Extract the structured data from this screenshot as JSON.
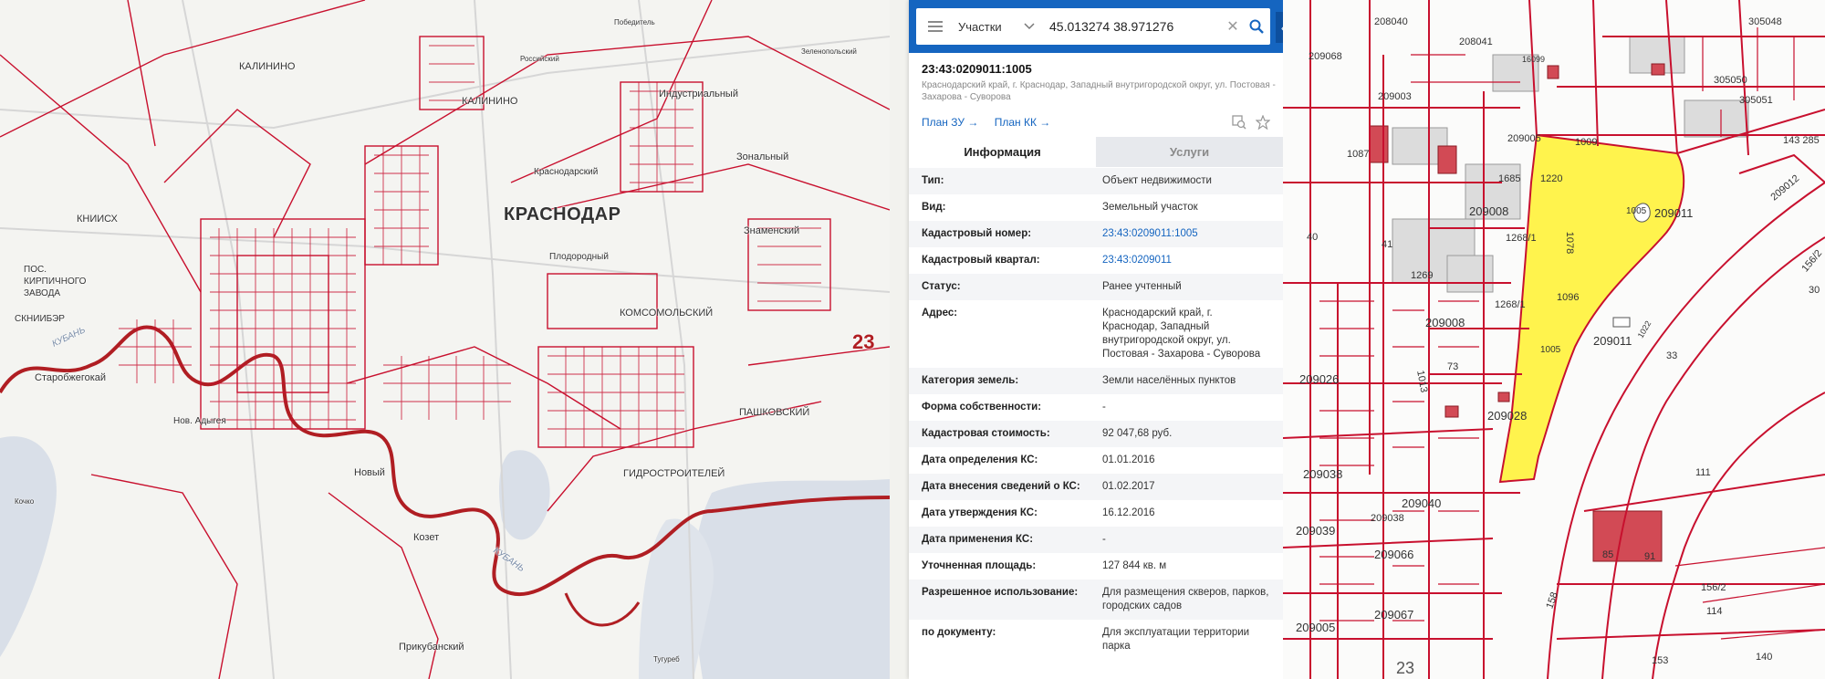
{
  "map_left": {
    "city_label": "КРАСНОДАР",
    "region_number": "23",
    "places": [
      "КАЛИНИНО",
      "КАЛИНИНО",
      "Индустриальный",
      "Зональный",
      "Знаменский",
      "Краснодарский",
      "Плодородный",
      "КОМСОМОЛЬСКИЙ",
      "ПАШКОВСКИЙ",
      "ГИДРОСТРОИТЕЛЕЙ",
      "КНИИСХ",
      "ПОС. КИРПИЧНОГО ЗАВОДА",
      "СКНИИБЭР",
      "Старобжегокай",
      "Нов. Адыгея",
      "Новый",
      "Козет",
      "Прикубанский",
      "Победитель",
      "Российский",
      "Зеленопольский",
      "Тугуреб",
      "Кочко"
    ],
    "river_labels": [
      "КУБАНЬ",
      "КУБАНЬ"
    ]
  },
  "search": {
    "menu_icon": "hamburger-icon",
    "layer": "Участки",
    "query": "45.013274 38.971276",
    "clear_icon": "close-icon",
    "search_icon": "search-icon",
    "collapse_icon": "chevron-left-icon"
  },
  "object": {
    "number": "23:43:0209011:1005",
    "address": "Краснодарский край, г. Краснодар, Западный внутригородской округ, ул. Постовая - Захарова - Суворова",
    "links": [
      "План ЗУ →",
      "План КК →"
    ]
  },
  "tabs": [
    "Информация",
    "Услуги"
  ],
  "info": [
    {
      "k": "Тип:",
      "v": "Объект недвижимости",
      "link": false
    },
    {
      "k": "Вид:",
      "v": "Земельный участок",
      "link": false
    },
    {
      "k": "Кадастровый номер:",
      "v": "23:43:0209011:1005",
      "link": true
    },
    {
      "k": "Кадастровый квартал:",
      "v": "23:43:0209011",
      "link": true
    },
    {
      "k": "Статус:",
      "v": "Ранее учтенный",
      "link": false
    },
    {
      "k": "Адрес:",
      "v": "Краснодарский край, г. Краснодар, Западный внутригородской округ, ул. Постовая - Захарова - Суворова",
      "link": false
    },
    {
      "k": "Категория земель:",
      "v": "Земли населённых пунктов",
      "link": false
    },
    {
      "k": "Форма собственности:",
      "v": "-",
      "link": false
    },
    {
      "k": "Кадастровая стоимость:",
      "v": "92 047,68 руб.",
      "link": false
    },
    {
      "k": "Дата определения КС:",
      "v": "01.01.2016",
      "link": false
    },
    {
      "k": "Дата внесения сведений о КС:",
      "v": "01.02.2017",
      "link": false
    },
    {
      "k": "Дата утверждения КС:",
      "v": "16.12.2016",
      "link": false
    },
    {
      "k": "Дата применения КС:",
      "v": "-",
      "link": false
    },
    {
      "k": "Уточненная площадь:",
      "v": "127 844 кв. м",
      "link": false
    },
    {
      "k": "Разрешенное использование:",
      "v": "Для размещения скверов, парков, городских садов",
      "link": false
    },
    {
      "k": "по документу:",
      "v": "Для эксплуатации территории парка",
      "link": false
    }
  ],
  "map_right": {
    "labels": [
      "208040",
      "208041",
      "305048",
      "209068",
      "16099",
      "305050",
      "209003",
      "305051",
      "143 285",
      "1087",
      "1685",
      "209005",
      "1009",
      "1220",
      "209008",
      "1005",
      "209011",
      "209012",
      "40",
      "41",
      "1268/1",
      "1078",
      "1269",
      "209008",
      "1096",
      "1268/1",
      "209011",
      "1005",
      "1022",
      "33",
      "209026",
      "73",
      "209028",
      "1013",
      "209038",
      "209040",
      "209038",
      "209039",
      "209066",
      "209067",
      "209005",
      "111",
      "85",
      "91",
      "156/2",
      "114",
      "158",
      "153",
      "140",
      "23",
      "30",
      "156/2"
    ]
  },
  "colors": {
    "cadastre_red": "#c8102e",
    "highlight_yellow": "#fff34d",
    "panel_blue": "#1565c0",
    "water": "#d9dfe8"
  }
}
